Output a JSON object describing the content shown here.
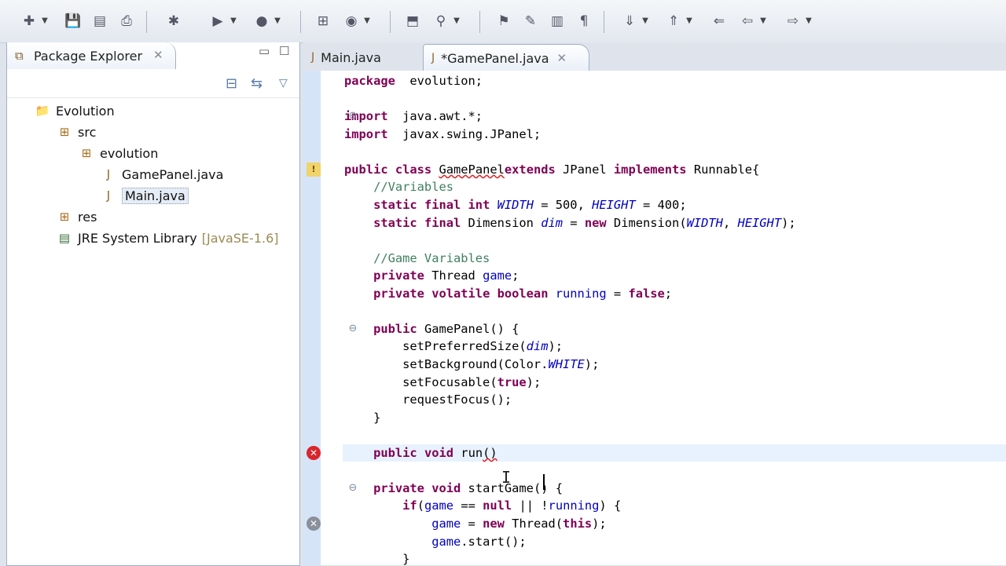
{
  "toolbar": {
    "buttons": [
      {
        "name": "new-wizard-icon",
        "glyph": "✚"
      },
      {
        "name": "save-icon",
        "glyph": "💾"
      },
      {
        "name": "save-all-icon",
        "glyph": "▤"
      },
      {
        "name": "print-icon",
        "glyph": "⎙"
      },
      {
        "name": "debug-icon",
        "glyph": "✱"
      },
      {
        "name": "run-icon",
        "glyph": "▶"
      },
      {
        "name": "external-tools-icon",
        "glyph": "●"
      },
      {
        "name": "new-java-package-icon",
        "glyph": "⊞"
      },
      {
        "name": "new-java-class-icon",
        "glyph": "◉"
      },
      {
        "name": "open-type-icon",
        "glyph": "⬒"
      },
      {
        "name": "search-icon",
        "glyph": "⚲"
      },
      {
        "name": "toggle-breadcrumb-icon",
        "glyph": "⚑"
      },
      {
        "name": "mark-occurrences-icon",
        "glyph": "✎"
      },
      {
        "name": "block-selection-icon",
        "glyph": "▥"
      },
      {
        "name": "show-whitespace-icon",
        "glyph": "¶"
      },
      {
        "name": "next-annotation-icon",
        "glyph": "⇓"
      },
      {
        "name": "previous-annotation-icon",
        "glyph": "⇑"
      },
      {
        "name": "last-edit-location-icon",
        "glyph": "⇐"
      },
      {
        "name": "back-icon",
        "glyph": "⇦"
      },
      {
        "name": "forward-icon",
        "glyph": "⇨"
      }
    ]
  },
  "package_explorer": {
    "title": "Package Explorer",
    "tree": [
      {
        "label": "Evolution",
        "icon": "project-icon",
        "glyph": "📁",
        "depth": 0,
        "selected": false,
        "extra": ""
      },
      {
        "label": "src",
        "icon": "source-folder-icon",
        "glyph": "⊞",
        "depth": 1,
        "selected": false,
        "extra": ""
      },
      {
        "label": "evolution",
        "icon": "package-icon",
        "glyph": "⊞",
        "depth": 2,
        "selected": false,
        "extra": ""
      },
      {
        "label": "GamePanel.java",
        "icon": "java-file-icon",
        "glyph": "J",
        "depth": 3,
        "selected": false,
        "extra": ""
      },
      {
        "label": "Main.java",
        "icon": "java-file-icon",
        "glyph": "J",
        "depth": 3,
        "selected": true,
        "extra": ""
      },
      {
        "label": "res",
        "icon": "folder-icon",
        "glyph": "⊞",
        "depth": 1,
        "selected": false,
        "extra": ""
      },
      {
        "label": "JRE System Library",
        "icon": "library-icon",
        "glyph": "▤",
        "depth": 1,
        "selected": false,
        "extra": "[JavaSE-1.6]"
      }
    ]
  },
  "editor": {
    "tabs": [
      {
        "label": "Main.java",
        "active": false
      },
      {
        "label": "*GamePanel.java",
        "active": true
      }
    ],
    "lines": [
      [
        [
          "kw",
          "package"
        ],
        [
          "",
          "  evolution;"
        ]
      ],
      [],
      [
        [
          "kw",
          "import"
        ],
        [
          "",
          "  java.awt.*;"
        ]
      ],
      [
        [
          "kw",
          "import"
        ],
        [
          "",
          "  javax.swing.JPanel;"
        ]
      ],
      [],
      [
        [
          "kw",
          "public class"
        ],
        [
          "",
          " "
        ],
        [
          "err",
          "GamePanel"
        ],
        [
          "",
          "",
          " "
        ],
        [
          "kw",
          "extends"
        ],
        [
          "",
          " JPanel "
        ],
        [
          "kw",
          "implements"
        ],
        [
          "",
          " Runnable{"
        ]
      ],
      [
        [
          "",
          ""
        ],
        [
          "cm",
          "    //Variables"
        ]
      ],
      [
        [
          "",
          "    "
        ],
        [
          "kw",
          "static final int"
        ],
        [
          "",
          " "
        ],
        [
          "fi",
          "WIDTH"
        ],
        [
          "",
          " = 500, "
        ],
        [
          "fi",
          "HEIGHT"
        ],
        [
          "",
          " = 400;"
        ]
      ],
      [
        [
          "",
          "    "
        ],
        [
          "kw",
          "static final"
        ],
        [
          "",
          " Dimension "
        ],
        [
          "fi",
          "dim"
        ],
        [
          "",
          " = "
        ],
        [
          "kw",
          "new"
        ],
        [
          "",
          " Dimension("
        ],
        [
          "fi",
          "WIDTH"
        ],
        [
          "",
          ", "
        ],
        [
          "fi",
          "HEIGHT"
        ],
        [
          "",
          ");"
        ]
      ],
      [],
      [
        [
          "cm",
          "    //Game Variables"
        ]
      ],
      [
        [
          "",
          "    "
        ],
        [
          "kw",
          "private"
        ],
        [
          "",
          " Thread "
        ],
        [
          "fn",
          "game"
        ],
        [
          "",
          ";"
        ]
      ],
      [
        [
          "",
          "    "
        ],
        [
          "kw",
          "private volatile boolean"
        ],
        [
          "",
          " "
        ],
        [
          "fn",
          "running"
        ],
        [
          "",
          " = "
        ],
        [
          "kw",
          "false"
        ],
        [
          "",
          ";"
        ]
      ],
      [],
      [
        [
          "",
          "    "
        ],
        [
          "kw",
          "public"
        ],
        [
          "",
          " GamePanel() {"
        ]
      ],
      [
        [
          "",
          "        setPreferredSize("
        ],
        [
          "fi",
          "dim"
        ],
        [
          "",
          ");"
        ]
      ],
      [
        [
          "",
          "        setBackground(Color."
        ],
        [
          "fi",
          "WHITE"
        ],
        [
          "",
          ");"
        ]
      ],
      [
        [
          "",
          "        setFocusable("
        ],
        [
          "kw",
          "true"
        ],
        [
          "",
          ");"
        ]
      ],
      [
        [
          "",
          "        requestFocus();"
        ]
      ],
      [
        [
          "",
          "    }"
        ]
      ],
      [],
      [
        [
          "",
          "    "
        ],
        [
          "kw",
          "public void"
        ],
        [
          "",
          " r"
        ],
        [
          "",
          "un"
        ],
        [
          "err",
          "()"
        ],
        [
          "",
          " "
        ]
      ],
      [],
      [
        [
          "",
          "    "
        ],
        [
          "kw",
          "private void"
        ],
        [
          "",
          " startGame() {"
        ]
      ],
      [
        [
          "",
          "        "
        ],
        [
          "kw",
          "if"
        ],
        [
          "",
          "("
        ],
        [
          "fn",
          "game"
        ],
        [
          "",
          " == "
        ],
        [
          "kw",
          "null"
        ],
        [
          "",
          " || !"
        ],
        [
          "fn",
          "running"
        ],
        [
          "",
          ") {"
        ]
      ],
      [
        [
          "",
          "            "
        ],
        [
          "fn",
          "game"
        ],
        [
          "",
          " = "
        ],
        [
          "kw",
          "new"
        ],
        [
          "",
          " Thread("
        ],
        [
          "kw",
          "this"
        ],
        [
          "",
          ");"
        ]
      ],
      [
        [
          "",
          "            "
        ],
        [
          "fn",
          "game"
        ],
        [
          "",
          ".start();"
        ]
      ],
      [
        [
          "",
          "        }"
        ]
      ]
    ]
  }
}
